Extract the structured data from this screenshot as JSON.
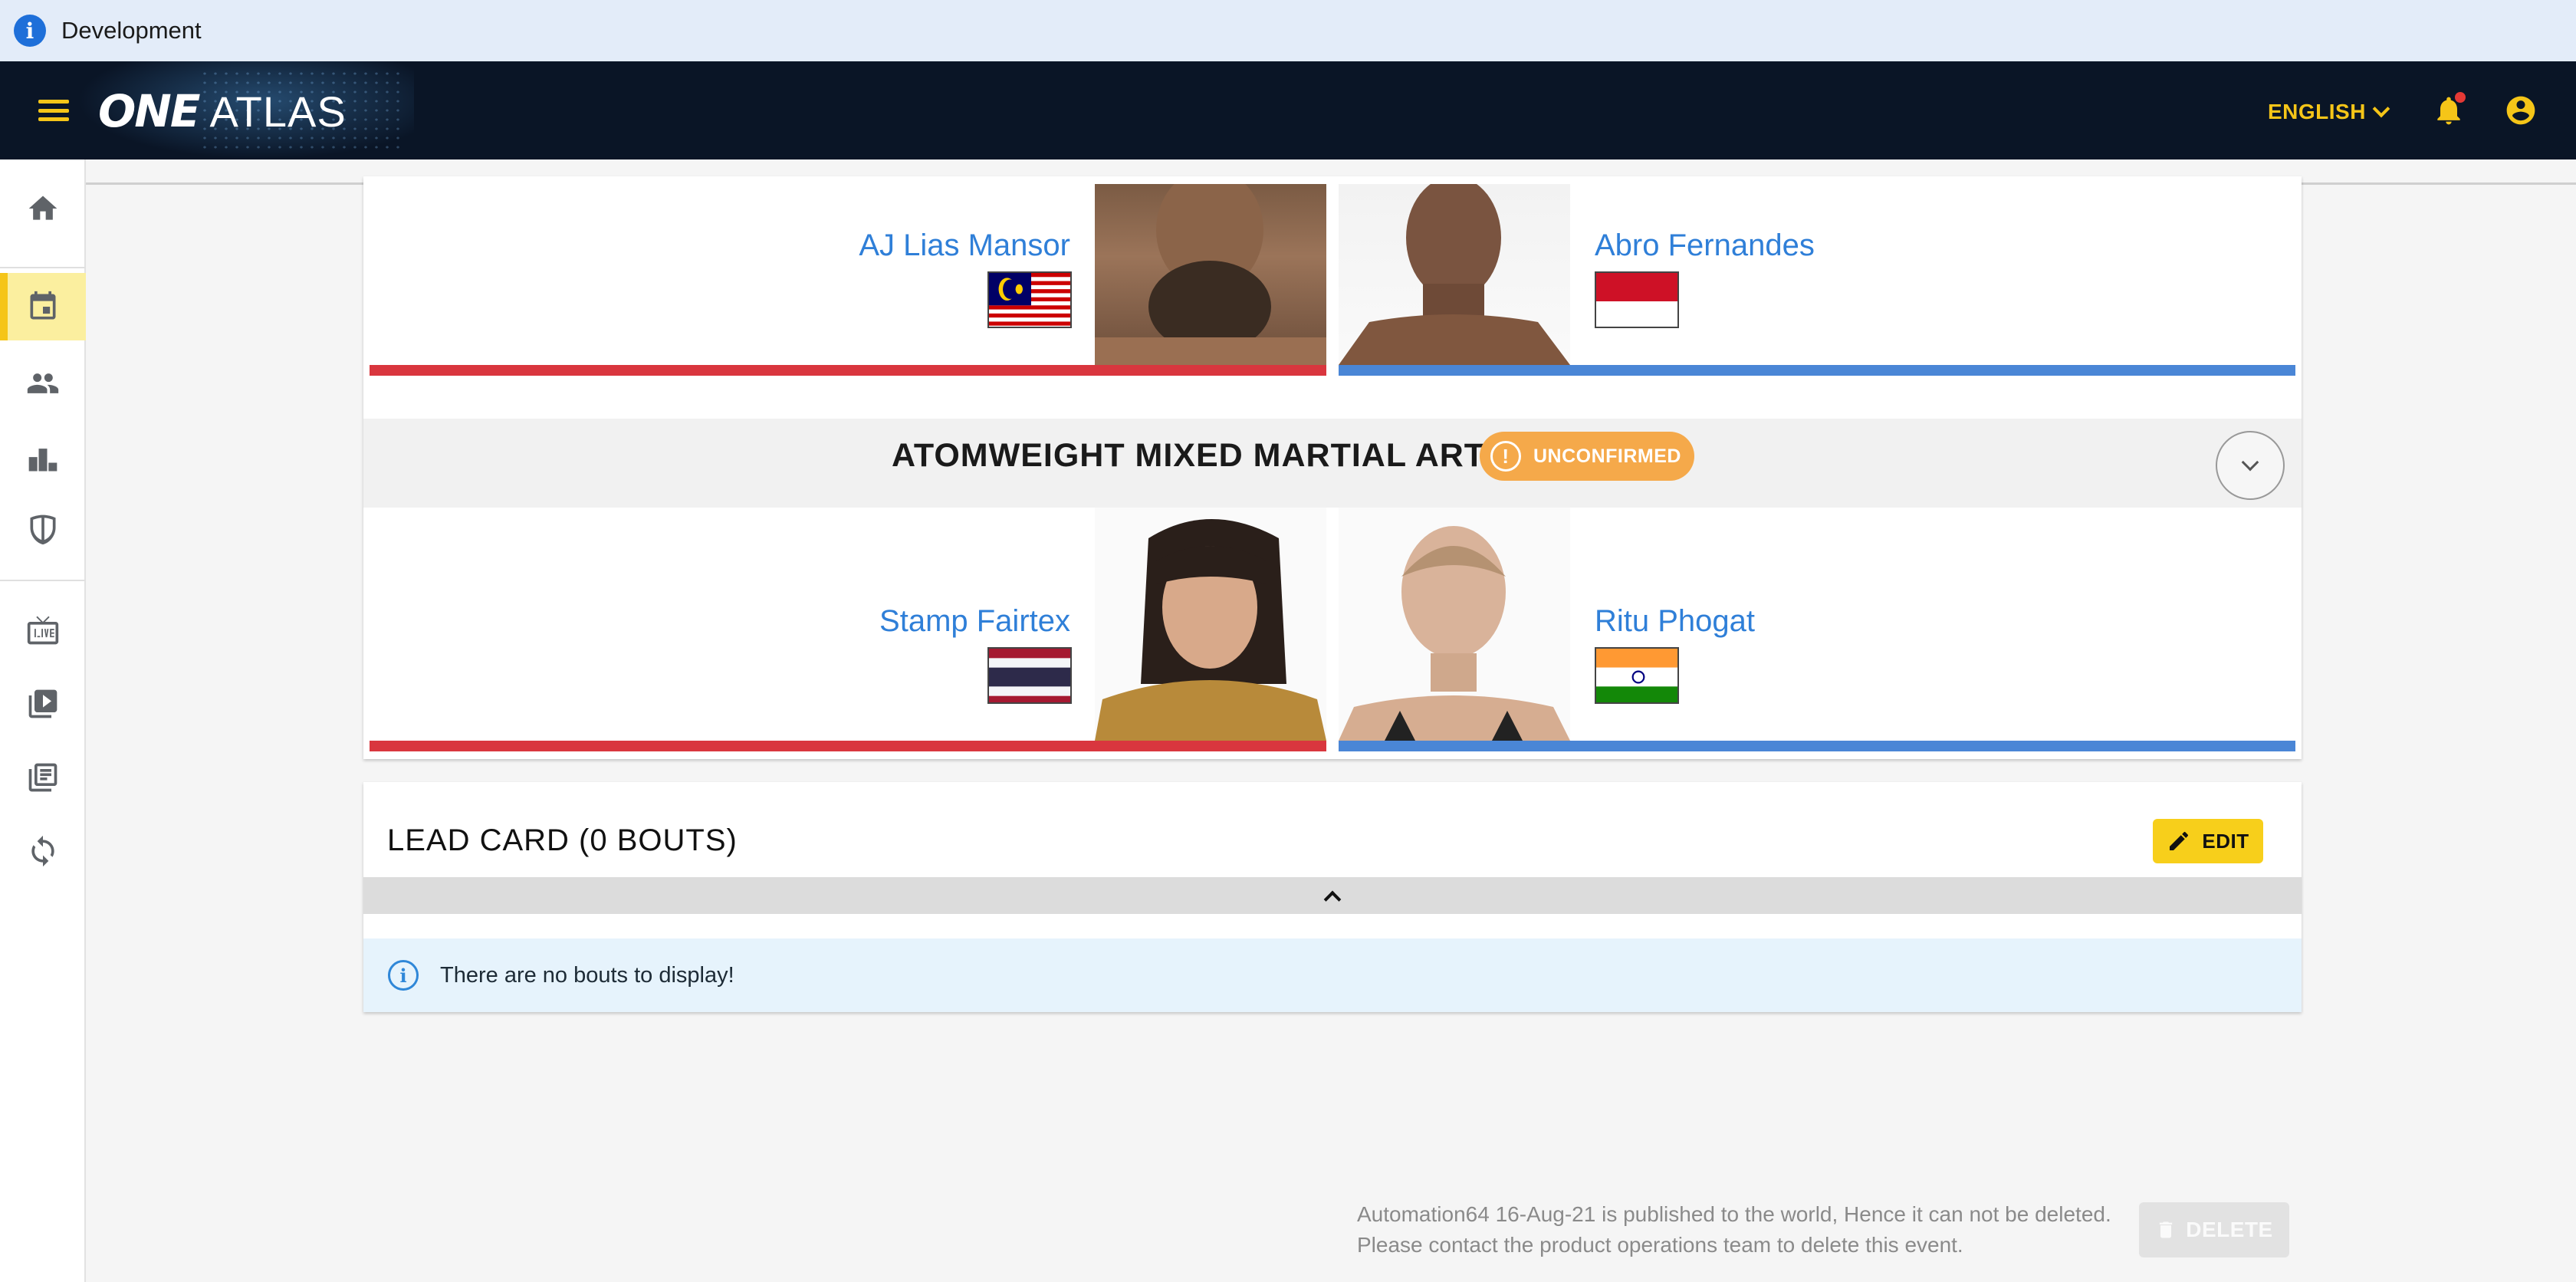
{
  "env_banner": {
    "text": "Development",
    "icon": "info-icon"
  },
  "appbar": {
    "logo_one": "ONE",
    "logo_atlas": "ATLAS",
    "language": "ENGLISH",
    "icons": [
      "menu-icon",
      "bell-icon",
      "account-circle-icon"
    ],
    "brand_color": "#f5c518",
    "bg_color": "#0a1526"
  },
  "sidenav": {
    "items": [
      {
        "name": "home",
        "icon": "home-icon"
      },
      {
        "name": "events",
        "icon": "calendar-icon",
        "active": true
      },
      {
        "name": "athletes",
        "icon": "people-icon"
      },
      {
        "name": "rankings",
        "icon": "podium-icon"
      },
      {
        "name": "promotions",
        "icon": "shield-icon"
      },
      {
        "name": "live",
        "icon": "live-tv-icon"
      },
      {
        "name": "videos",
        "icon": "video-library-icon"
      },
      {
        "name": "collections",
        "icon": "library-icon"
      },
      {
        "name": "sync",
        "icon": "sync-icon"
      }
    ]
  },
  "bouts": [
    {
      "red": {
        "name": "AJ Lias Mansor",
        "flag": "malaysia"
      },
      "blue": {
        "name": "Abro Fernandes",
        "flag": "indonesia"
      }
    },
    {
      "title": "ATOMWEIGHT MIXED MARTIAL ARTS",
      "status": "UNCONFIRMED",
      "red": {
        "name": "Stamp Fairtex",
        "flag": "thailand"
      },
      "blue": {
        "name": "Ritu Phogat",
        "flag": "india"
      }
    }
  ],
  "lead_card": {
    "title": "LEAD CARD (0 BOUTS)",
    "edit_label": "EDIT",
    "empty_message": "There are no bouts to display!"
  },
  "footer": {
    "line1": "Automation64 16-Aug-21 is published to the world, Hence it can not be deleted.",
    "line2": "Please contact the product operations team to delete this event.",
    "delete_label": "DELETE"
  },
  "colors": {
    "red_corner": "#d9363e",
    "blue_corner": "#4a86d6",
    "unconfirmed": "#f5a94a",
    "link": "#2f7fd8"
  }
}
